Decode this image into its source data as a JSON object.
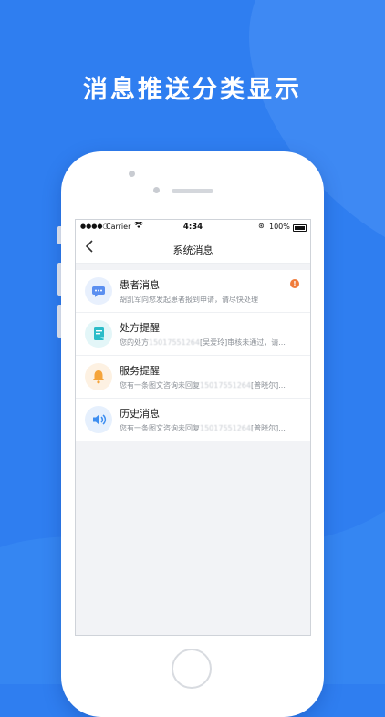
{
  "headline": "消息推送分类显示",
  "statusbar": {
    "carrier": "Carrier",
    "time": "4:34",
    "battery": "100%"
  },
  "navbar": {
    "back_icon": "chevron-left-icon",
    "title": "系统消息"
  },
  "messages": [
    {
      "title": "患者消息",
      "icon": "chat-bubble-icon",
      "icon_color": "#5b8ff0",
      "desc": "胡凯军向您发起患者报到申请，请尽快处理",
      "unread_badge": "!"
    },
    {
      "title": "处方提醒",
      "icon": "prescription-icon",
      "icon_color": "#2bbcc8",
      "desc_prefix": "您的处方",
      "desc_masked": "15017551264",
      "desc_suffix": "[吴爱玲]审核未通过，请..."
    },
    {
      "title": "服务提醒",
      "icon": "bell-icon",
      "icon_color": "#f5a43a",
      "desc_prefix": "您有一条图文咨询未回复",
      "desc_masked": "15017551264",
      "desc_suffix": "[普晓尔]..."
    },
    {
      "title": "历史消息",
      "icon": "speaker-icon",
      "icon_color": "#3d8ef0",
      "desc_prefix": "您有一条图文咨询未回复",
      "desc_masked": "15017551264",
      "desc_suffix": "[普晓尔]..."
    }
  ],
  "colors": {
    "background": "#2f7ef0",
    "badge": "#f07b3a"
  }
}
